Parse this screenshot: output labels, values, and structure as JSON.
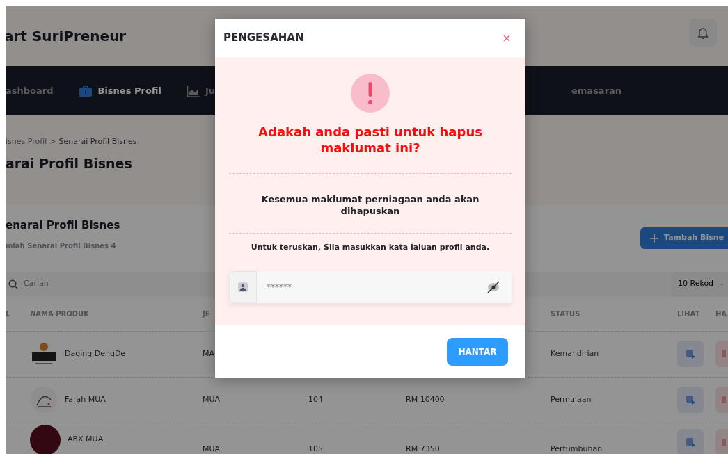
{
  "header": {
    "app_title": "art SuriPreneur"
  },
  "nav": {
    "items": [
      {
        "label": "ashboard",
        "kind": "plain",
        "selected": false
      },
      {
        "label": "Bisnes Profil",
        "kind": "briefcase",
        "selected": true
      },
      {
        "label": "Ju",
        "kind": "chart",
        "selected": false
      },
      {
        "label": "emasaran",
        "kind": "plain",
        "selected": false
      }
    ]
  },
  "breadcrumb": {
    "items": [
      "isnes Profil",
      "Senarai Profil Bisnes"
    ],
    "separator": ">"
  },
  "page_title": "arai Profil Bisnes",
  "card": {
    "title": "enarai Profil Bisnes",
    "subtitle": "mlah Senarai Profil Bisnes 4",
    "add_button": "Tambah Bisne",
    "search": {
      "placeholder": "Carian"
    },
    "page_size": "10 Rekod"
  },
  "table": {
    "columns": {
      "column_1": "L",
      "nama_produk": "NAMA PRODUK",
      "column_3": "JE",
      "status": "STATUS",
      "lihat": "LIHAT",
      "column_8": "HA"
    },
    "rows": [
      {
        "kind": "emblem",
        "name": "Daging DengDe",
        "column_3": "MA",
        "status": "Kemandirian"
      },
      {
        "kind": "sketch",
        "name": "Farah MUA",
        "column_3": "MUA",
        "column_4": "104",
        "column_5": "RM 10400",
        "status": "Permulaan"
      },
      {
        "kind": "circle",
        "name": "ABX MUA",
        "column_3": "MUA",
        "column_4": "105",
        "column_5": "RM 7350",
        "status": "Pertumbuhan"
      }
    ]
  },
  "modal": {
    "title": "PENGESAHAN",
    "heading": "Adakah anda pasti untuk hapus maklumat ini?",
    "warning": "Kesemua maklumat perniagaan anda akan dihapuskan",
    "instruction": "Untuk teruskan, Sila masukkan kata laluan profil anda.",
    "password": {
      "placeholder": "******"
    },
    "submit": "HANTAR"
  }
}
